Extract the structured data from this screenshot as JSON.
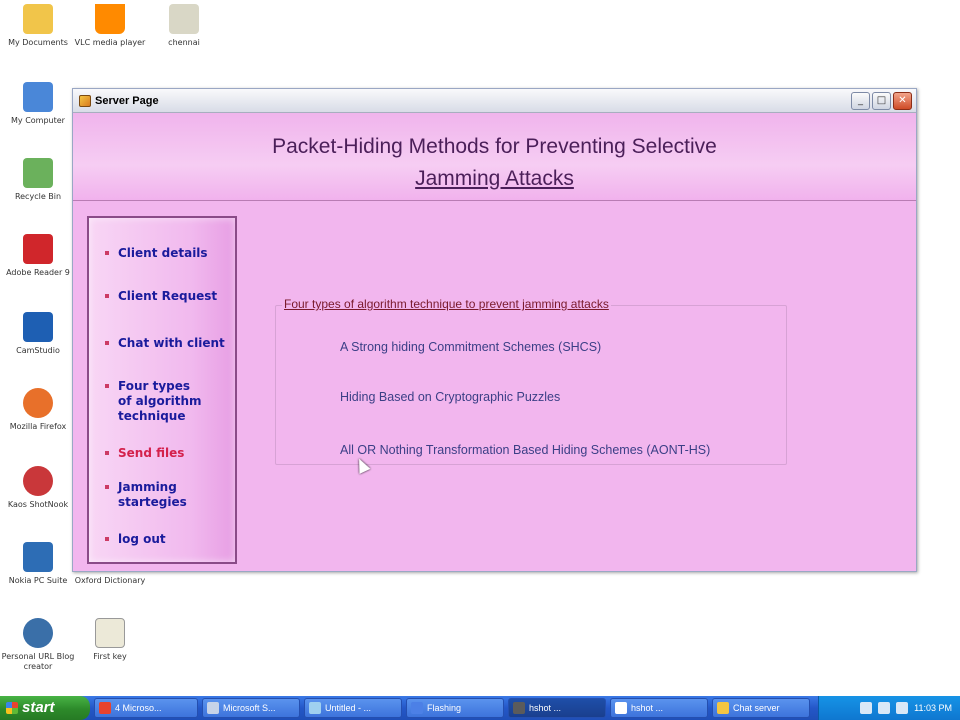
{
  "desktop": {
    "icons": [
      {
        "label": "My Documents",
        "color": "#f1c54a"
      },
      {
        "label": "VLC media player",
        "color": "#ff8a00"
      },
      {
        "label": "chennai",
        "color": "#d9d7c6"
      },
      {
        "label": "My Computer",
        "color": "#4a87d8"
      },
      {
        "label": "Recycle Bin",
        "color": "#6bb15c"
      },
      {
        "label": "Adobe Reader 9",
        "color": "#d0262b"
      },
      {
        "label": "CamStudio",
        "color": "#1e5fb3"
      },
      {
        "label": "Mozilla Firefox",
        "color": "#e8702a"
      },
      {
        "label": "Kaos ShotNook",
        "color": "#c9373a"
      },
      {
        "label": "Nokia PC Suite",
        "color": "#2d6db5"
      },
      {
        "label": "Oxford Dictionary",
        "color": "#f3f3f3"
      },
      {
        "label": "Personal URL Blog creator",
        "color": "#3a6fa8"
      },
      {
        "label": "First key",
        "color": "#ece9d8"
      }
    ]
  },
  "window": {
    "title": "Server Page",
    "buttons": {
      "minimize": "_",
      "maximize": "□",
      "close": "✕"
    },
    "header": {
      "line1": "Packet-Hiding Methods for Preventing Selective",
      "line2": "Jamming Attacks"
    },
    "sidebar": {
      "items": [
        {
          "label": "Client details"
        },
        {
          "label": "Client Request"
        },
        {
          "label": "Chat with client"
        },
        {
          "label": "Four types\nof algorithm\ntechnique"
        },
        {
          "label": "Send files"
        },
        {
          "label": "Jamming\nstartegies"
        },
        {
          "label": "log out"
        }
      ]
    },
    "groupbox": {
      "title": "Four types of algorithm technique to prevent jamming attacks",
      "items": [
        "A Strong hiding Commitment Schemes (SHCS)",
        "Hiding Based on Cryptographic Puzzles",
        "All OR Nothing Transformation Based Hiding Schemes (AONT-HS)"
      ]
    }
  },
  "taskbar": {
    "start_label": "start",
    "tasks": [
      {
        "label": "4 Microso..."
      },
      {
        "label": "Microsoft S..."
      },
      {
        "label": "Untitled - ..."
      },
      {
        "label": "Flashing"
      },
      {
        "label": "hshot ..."
      },
      {
        "label": "hshot ..."
      },
      {
        "label": "Chat server"
      }
    ],
    "clock": "11:03 PM"
  }
}
